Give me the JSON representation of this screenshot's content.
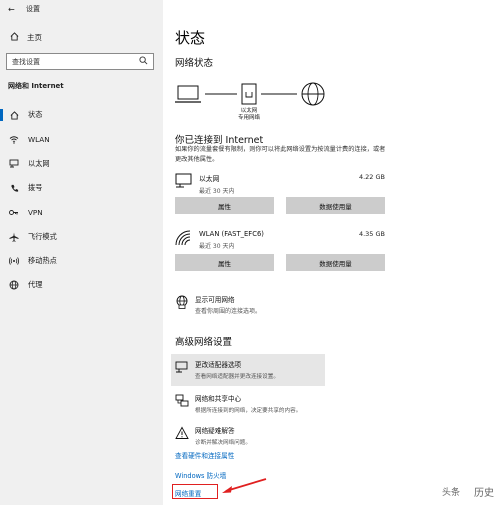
{
  "window": {
    "title": "设置"
  },
  "sidebar": {
    "home_label": "主页",
    "search_placeholder": "查找设置",
    "section_label": "网络和 Internet",
    "items": [
      {
        "label": "状态",
        "icon": "home-icon"
      },
      {
        "label": "WLAN",
        "icon": "wifi-icon"
      },
      {
        "label": "以太网",
        "icon": "ethernet-icon"
      },
      {
        "label": "拨号",
        "icon": "dialup-icon"
      },
      {
        "label": "VPN",
        "icon": "vpn-icon"
      },
      {
        "label": "飞行模式",
        "icon": "airplane-icon"
      },
      {
        "label": "移动热点",
        "icon": "hotspot-icon"
      },
      {
        "label": "代理",
        "icon": "globe-icon"
      }
    ],
    "active_index": 0
  },
  "main": {
    "title": "状态",
    "status_heading": "网络状态",
    "diagram_label_1": "以太网",
    "diagram_label_2": "专用网络",
    "connected_heading": "你已连接到 Internet",
    "connected_desc": "如果你的流量套餐有限制，则你可以将此网络设置为按流量计费的连接，或者更改其他属性。",
    "connections": [
      {
        "name": "以太网",
        "meta": "最近 30 天内",
        "size": "4.22 GB",
        "btn1": "属性",
        "btn2": "数据使用量"
      },
      {
        "name": "WLAN (FAST_EFC6)",
        "meta": "最近 30 天内",
        "size": "4.35 GB",
        "btn1": "属性",
        "btn2": "数据使用量"
      }
    ],
    "show_networks": {
      "title": "显示可用网络",
      "subtitle": "查看你周围的连接选项。"
    },
    "advanced_heading": "高级网络设置",
    "advanced": [
      {
        "title": "更改适配器选项",
        "subtitle": "查看网络适配器并更改连接设置。"
      },
      {
        "title": "网络和共享中心",
        "subtitle": "根据所连接到的网络，决定要共享的内容。"
      },
      {
        "title": "网络疑难解答",
        "subtitle": "诊断并解决网络问题。"
      }
    ],
    "links": {
      "hardware": "查看硬件和连接属性",
      "firewall": "Windows 防火墙",
      "reset": "网络重置"
    }
  },
  "watermark": {
    "brand": "头条",
    "text": "历史"
  },
  "colors": {
    "accent": "#0067c0",
    "highlight_box": "#e02020",
    "button": "#cccccc"
  }
}
